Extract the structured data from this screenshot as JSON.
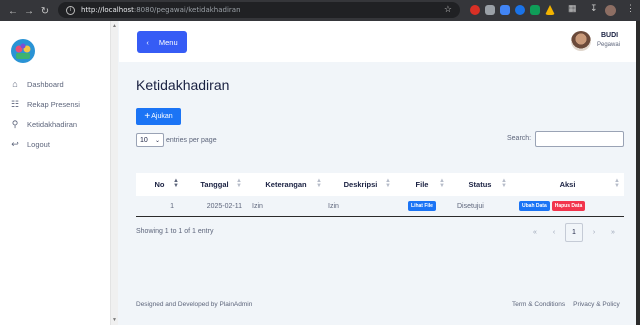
{
  "browser": {
    "url_host": "http://localhost",
    "url_path": ":8080/pegawai/ketidakhadiran"
  },
  "sidebar": {
    "items": [
      {
        "label": "Dashboard",
        "icon": "home-icon"
      },
      {
        "label": "Rekap Presensi",
        "icon": "file-icon"
      },
      {
        "label": "Ketidakhadiran",
        "icon": "user-icon"
      },
      {
        "label": "Logout",
        "icon": "logout-icon"
      }
    ]
  },
  "header": {
    "menu_label": "Menu",
    "menu_icon": "chevron-left-icon",
    "user_name": "BUDI",
    "user_role": "Pegawai"
  },
  "main": {
    "title": "Ketidakhadiran",
    "ajukan_label": "Ajukan",
    "per_page_value": "10",
    "per_page_text": "entries per page",
    "search_label": "Search:",
    "search_value": ""
  },
  "table": {
    "columns": [
      "No",
      "Tanggal",
      "Keterangan",
      "Deskripsi",
      "File",
      "Status",
      "Aksi"
    ],
    "rows": [
      {
        "no": "1",
        "tanggal": "2025-02-11",
        "keterangan": "Izin",
        "deskripsi": "Izin",
        "file_label": "Lihat File",
        "status": "Disetujui",
        "edit_label": "Ubah Data",
        "delete_label": "Hapus Data"
      }
    ]
  },
  "pagination": {
    "info": "Showing 1 to 1 of 1 entry",
    "first": "«",
    "prev": "‹",
    "current": "1",
    "next": "›",
    "last": "»"
  },
  "footer": {
    "left": "Designed and Developed by PlainAdmin",
    "terms": "Term & Conditions",
    "privacy": "Privacy & Policy"
  },
  "colors": {
    "primary": "#365cf5",
    "button_blue": "#1b74f5",
    "danger": "#f2344c",
    "background": "#f1f5f9"
  }
}
